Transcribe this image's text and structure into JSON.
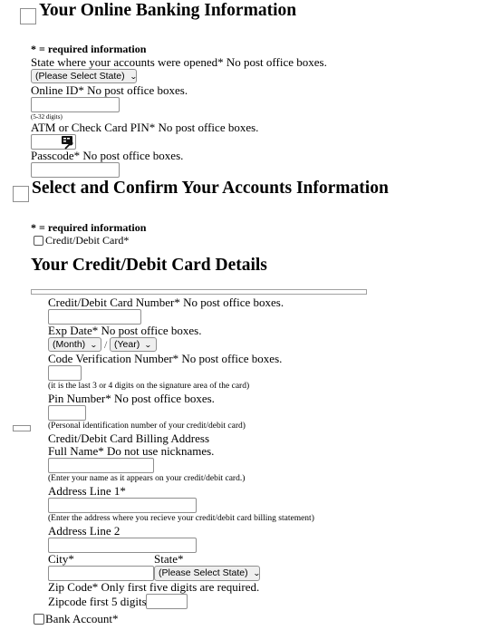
{
  "online_banking": {
    "heading": "Your Online Banking Information",
    "required_note": "* = required information",
    "state_label": "State where your accounts were opened* No post office boxes.",
    "state_select": "(Please Select State)",
    "online_id_label": "Online ID* No post office boxes.",
    "online_id_value": "",
    "online_id_hint": "(5-32 digits)",
    "pin_label": "ATM or Check Card PIN* No post office boxes.",
    "pin_value": "",
    "keypad_icon": "keypad-key-icon",
    "passcode_label": "Passcode* No post office boxes.",
    "passcode_value": ""
  },
  "accounts": {
    "heading": "Select and Confirm Your Accounts Information",
    "required_note": "* = required information",
    "credit_debit_checkbox_label": "Credit/Debit Card*",
    "credit_debit_checked": false,
    "bank_account_checkbox_label": "Bank Account*",
    "bank_account_checked": false
  },
  "card_details": {
    "heading": "Your Credit/Debit Card Details",
    "card_number_label": "Credit/Debit Card Number* No post office boxes.",
    "card_number_value": "",
    "exp_label": "Exp Date* No post office boxes.",
    "exp_month": "(Month)",
    "exp_separator": "/",
    "exp_year": "(Year)",
    "cvn_label": "Code Verification Number* No post office boxes.",
    "cvn_value": "",
    "cvn_hint": "(it is the last 3 or 4 digits on the signature area of the card)",
    "pin_label": "Pin Number* No post office boxes.",
    "pin_value": "",
    "pin_hint": "(Personal identification number of your credit/debit card)",
    "billing_heading": "Credit/Debit Card Billing Address",
    "full_name_label": "Full Name* Do not use nicknames.",
    "full_name_value": "",
    "full_name_hint": "(Enter your name as it appears on your credit/debit card.)",
    "address1_label": "Address Line 1*",
    "address1_value": "",
    "address1_hint": "(Enter the address where you recieve your credit/debit card billing statement)",
    "address2_label": "Address Line 2",
    "address2_value": "",
    "city_label": "City*",
    "city_value": "",
    "state_label": "State*",
    "state_select": "(Please Select State)",
    "zip_label": "Zip Code* Only first five digits are required.",
    "zip_first5_label": "Zipcode first 5 digits",
    "zip_value": ""
  },
  "icons": {
    "dropdown": "chevron-down-icon"
  }
}
